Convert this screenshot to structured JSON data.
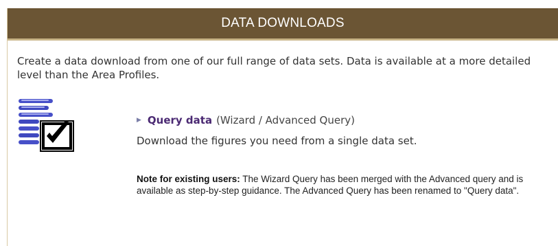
{
  "panel": {
    "title": "DATA DOWNLOADS",
    "intro": "Create a data download from one of our full range of data sets. Data is available at a more detailed level than the Area Profiles."
  },
  "query": {
    "icon": "dataset-checkbox-icon",
    "bullet_icon": "triangle-right-icon",
    "link_label": "Query data",
    "link_subtitle": "(Wizard / Advanced Query)",
    "description": "Download the figures you need from a single data set."
  },
  "note": {
    "label": "Note for existing users:",
    "text": " The Wizard Query has been merged with the Advanced query and is available as step-by-step guidance. The Advanced Query has been renamed to \"Query data\"."
  },
  "colors": {
    "header_bg": "#6b5534",
    "link": "#4b2a73"
  }
}
